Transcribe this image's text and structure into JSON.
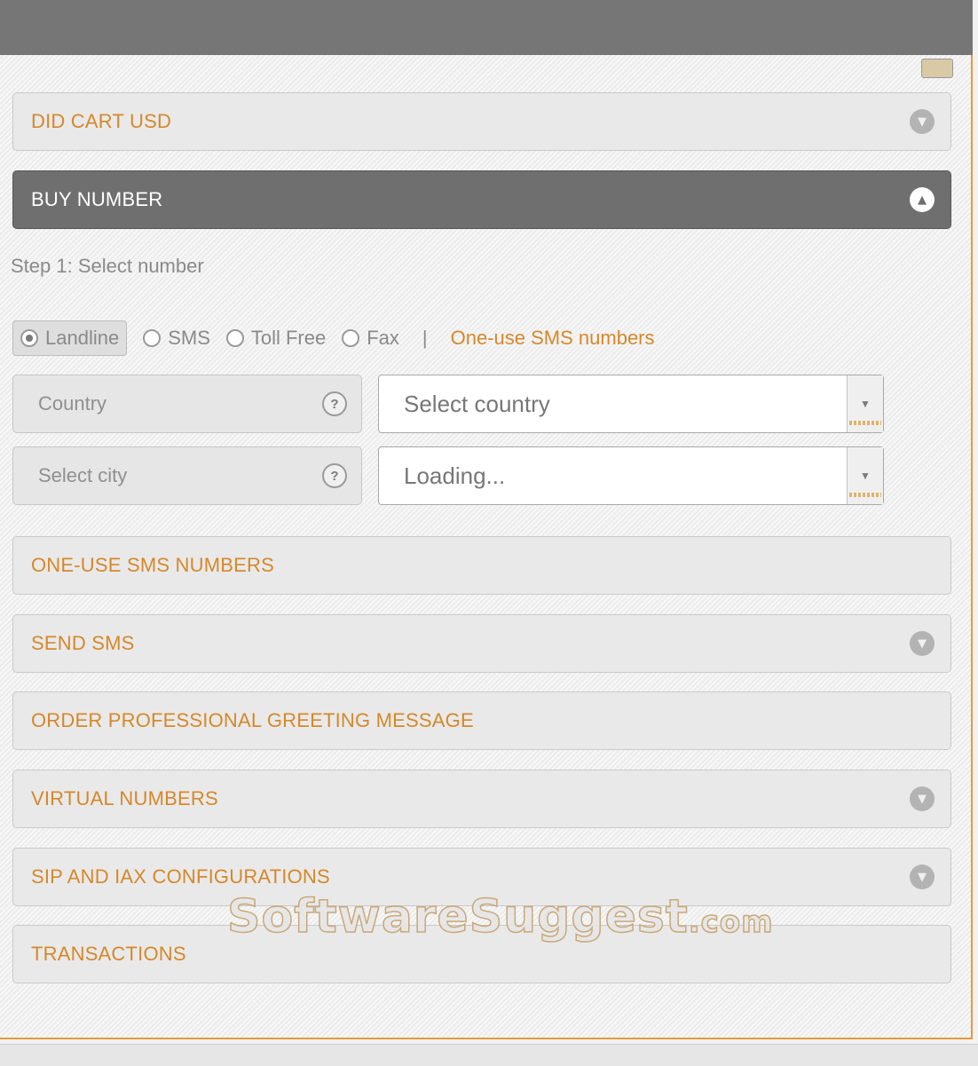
{
  "sections": {
    "cart": {
      "label": "DID CART   USD"
    },
    "buy_number": {
      "label": "BUY NUMBER"
    },
    "one_use_sms": {
      "label": "ONE-USE SMS NUMBERS"
    },
    "send_sms": {
      "label": "SEND SMS"
    },
    "greeting": {
      "label": "ORDER PROFESSIONAL GREETING MESSAGE"
    },
    "virtual_numbers": {
      "label": "VIRTUAL NUMBERS"
    },
    "sip_iax": {
      "label": "SIP AND IAX CONFIGURATIONS"
    },
    "transactions": {
      "label": "TRANSACTIONS"
    }
  },
  "buy": {
    "step_label": "Step 1: Select number",
    "types": [
      {
        "label": "Landline",
        "selected": true
      },
      {
        "label": "SMS",
        "selected": false
      },
      {
        "label": "Toll Free",
        "selected": false
      },
      {
        "label": "Fax",
        "selected": false
      }
    ],
    "separator": "|",
    "one_use_link": "One-use SMS numbers",
    "country": {
      "label": "Country",
      "help": "?",
      "value": "Select country"
    },
    "city": {
      "label": "Select city",
      "help": "?",
      "value": "Loading..."
    }
  },
  "watermark": {
    "main": "SoftwareSuggest",
    "suffix": ".com"
  },
  "icons": {
    "collapsed": "chevron-down-icon",
    "expanded": "chevron-up-icon"
  },
  "colors": {
    "accent": "#e69a3c",
    "label_orange": "#d6882a",
    "active_bar": "#6f6f6f",
    "top_bar": "#767676"
  }
}
